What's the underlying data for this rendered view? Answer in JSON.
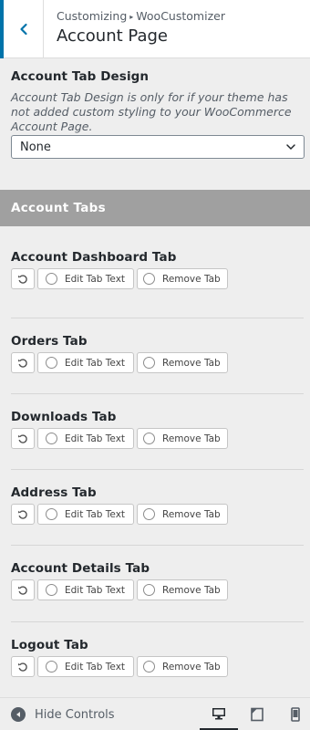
{
  "header": {
    "breadcrumb_parent": "Customizing",
    "breadcrumb_child": "WooCustomizer",
    "title": "Account Page",
    "back_icon": "chevron-left-icon"
  },
  "design": {
    "title": "Account Tab Design",
    "description": "Account Tab Design is only for if your theme has not added custom styling to your WooCommerce Account Page.",
    "select_value": "None"
  },
  "section": {
    "title": "Account Tabs"
  },
  "buttons": {
    "edit_label": "Edit Tab Text",
    "remove_label": "Remove Tab"
  },
  "tabs": [
    {
      "title": "Account Dashboard Tab"
    },
    {
      "title": "Orders Tab"
    },
    {
      "title": "Downloads Tab"
    },
    {
      "title": "Address Tab"
    },
    {
      "title": "Account Details Tab"
    },
    {
      "title": "Logout Tab"
    }
  ],
  "footer": {
    "hide_controls_label": "Hide Controls",
    "devices": [
      "desktop-icon",
      "tablet-icon",
      "mobile-icon"
    ],
    "active_device": "desktop"
  },
  "colors": {
    "accent": "#0073aa",
    "section_bar": "#a0a0a0",
    "background": "#eeeeee"
  }
}
